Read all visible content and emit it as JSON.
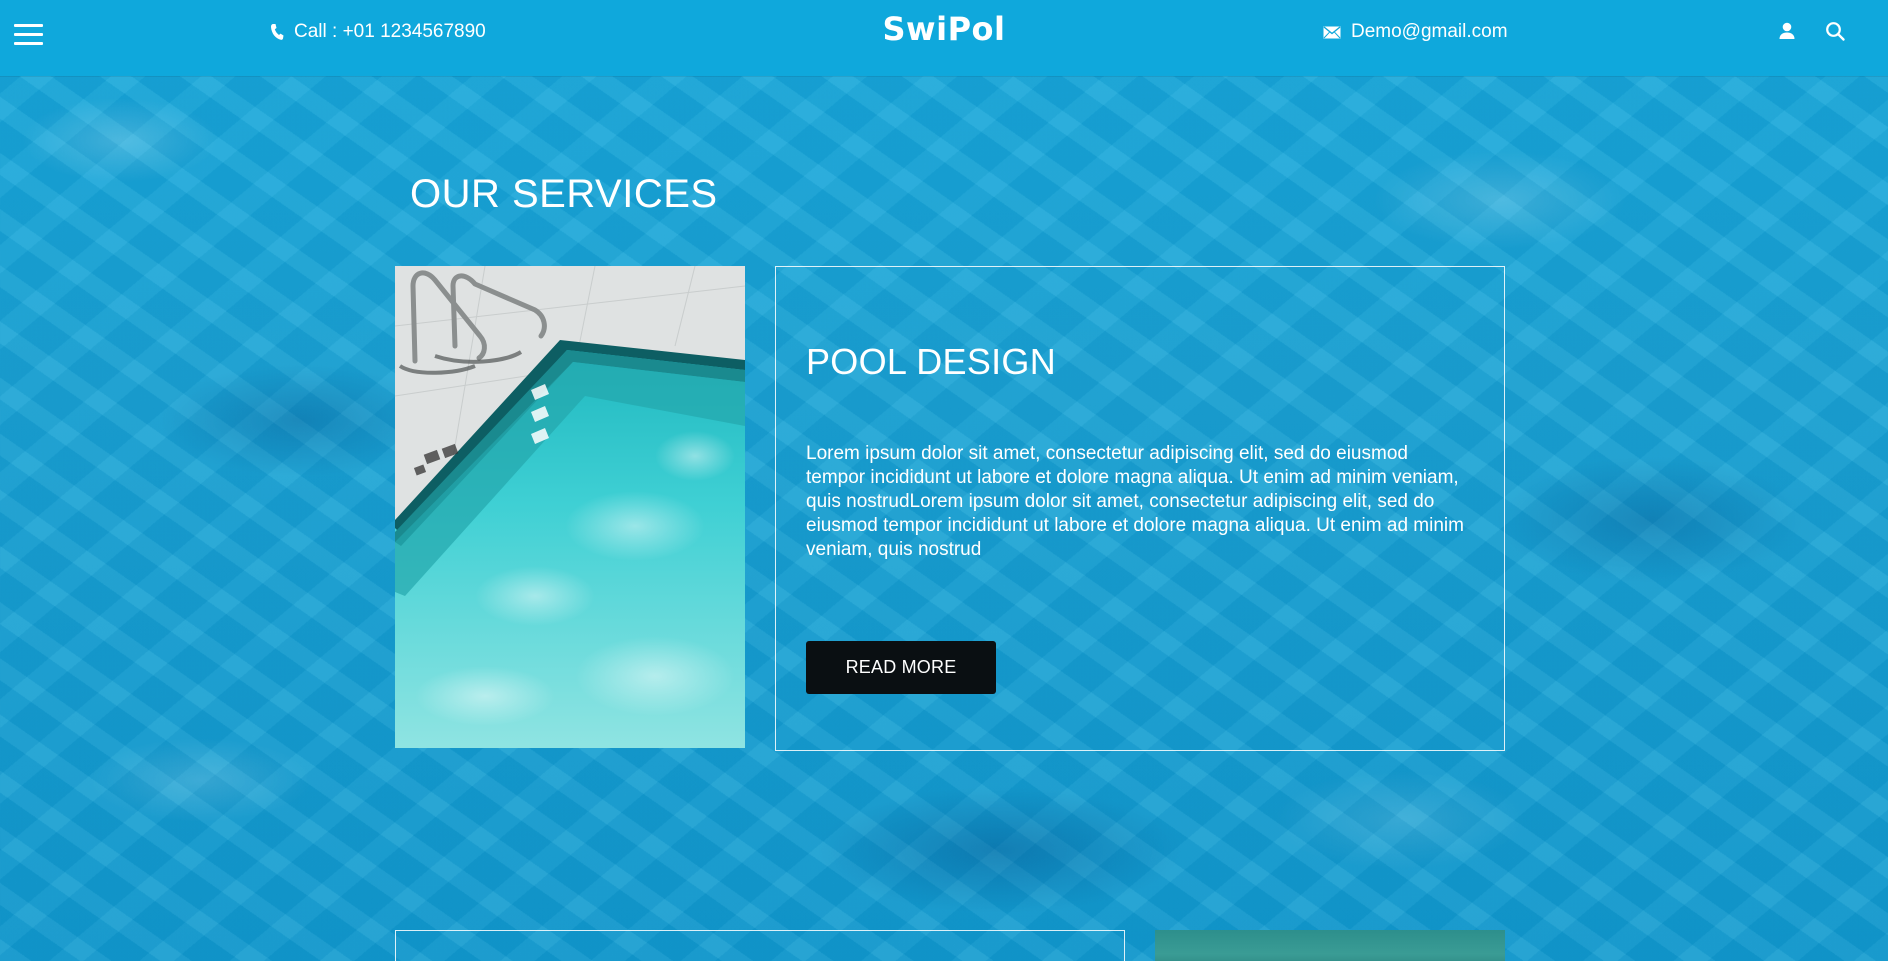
{
  "header": {
    "menu_icon": "hamburger-menu-icon",
    "phone_icon": "phone-icon",
    "phone_text": "Call : +01 1234567890",
    "brand": "SwiPol",
    "mail_icon": "mail-icon",
    "email_text": "Demo@gmail.com",
    "user_icon": "user-icon",
    "search_icon": "search-icon",
    "background_color": "#0fa8dc"
  },
  "services": {
    "section_title": "OUR SERVICES",
    "items": [
      {
        "title": "POOL DESIGN",
        "text": "Lorem ipsum dolor sit amet, consectetur adipiscing elit, sed do eiusmod tempor incididunt ut labore et dolore magna aliqua. Ut enim ad minim veniam, quis nostrudLorem ipsum dolor sit amet, consectetur adipiscing elit, sed do eiusmod tempor incididunt ut labore et dolore magna aliqua. Ut enim ad minim veniam, quis nostrud",
        "button_label": "READ MORE",
        "image": "pool-corner-photo"
      }
    ]
  },
  "colors": {
    "water_blue": "#14a4d6",
    "button_dark": "#0a0f12",
    "text": "#ffffff"
  }
}
